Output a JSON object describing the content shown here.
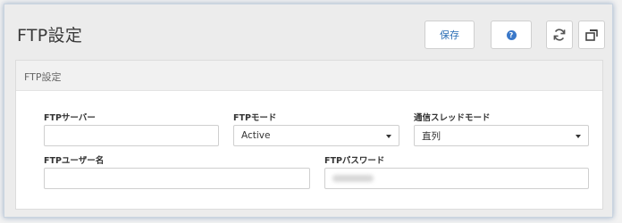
{
  "window": {
    "title": "FTP設定"
  },
  "toolbar": {
    "save_label": "保存",
    "help_icon": "help-circle-icon",
    "refresh_icon": "refresh-icon",
    "popout_icon": "popout-window-icon"
  },
  "panel": {
    "title": "FTP設定",
    "fields": {
      "ftp_server": {
        "label": "FTPサーバー",
        "value": ""
      },
      "ftp_mode": {
        "label": "FTPモード",
        "value": "Active"
      },
      "thread_mode": {
        "label": "通信スレッドモード",
        "value": "直列"
      },
      "ftp_user": {
        "label": "FTPユーザー名",
        "value": ""
      },
      "ftp_password": {
        "label": "FTPパスワード",
        "value": ""
      }
    }
  },
  "colors": {
    "accent": "#2a6db5",
    "help_icon": "#3a78c9"
  }
}
